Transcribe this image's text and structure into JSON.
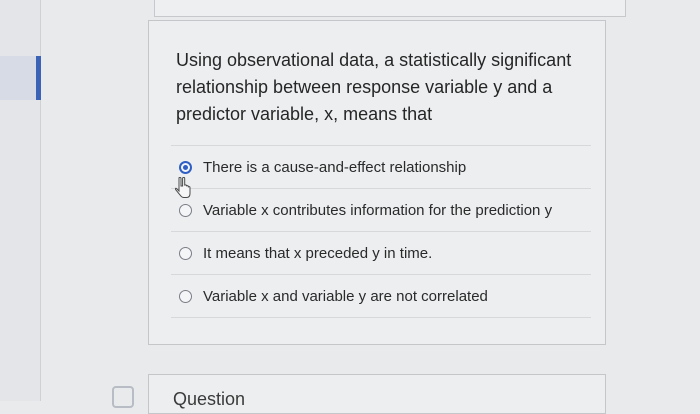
{
  "question": {
    "text": "Using observational data, a statistically significant relationship between response variable y and a predictor variable, x, means that",
    "options": [
      {
        "label": "There is a cause-and-effect relationship",
        "selected": true
      },
      {
        "label": "Variable x contributes information for the prediction y",
        "selected": false
      },
      {
        "label": "It means that x preceded y in time.",
        "selected": false
      },
      {
        "label": "Variable x and variable y are not correlated",
        "selected": false
      }
    ]
  },
  "next_card": {
    "title": "Question"
  },
  "colors": {
    "accent": "#2f5fc4",
    "nav_indicator": "#3a63b8"
  },
  "icons": {
    "cursor": "hand-pointer-icon",
    "bottom": "card-icon"
  }
}
